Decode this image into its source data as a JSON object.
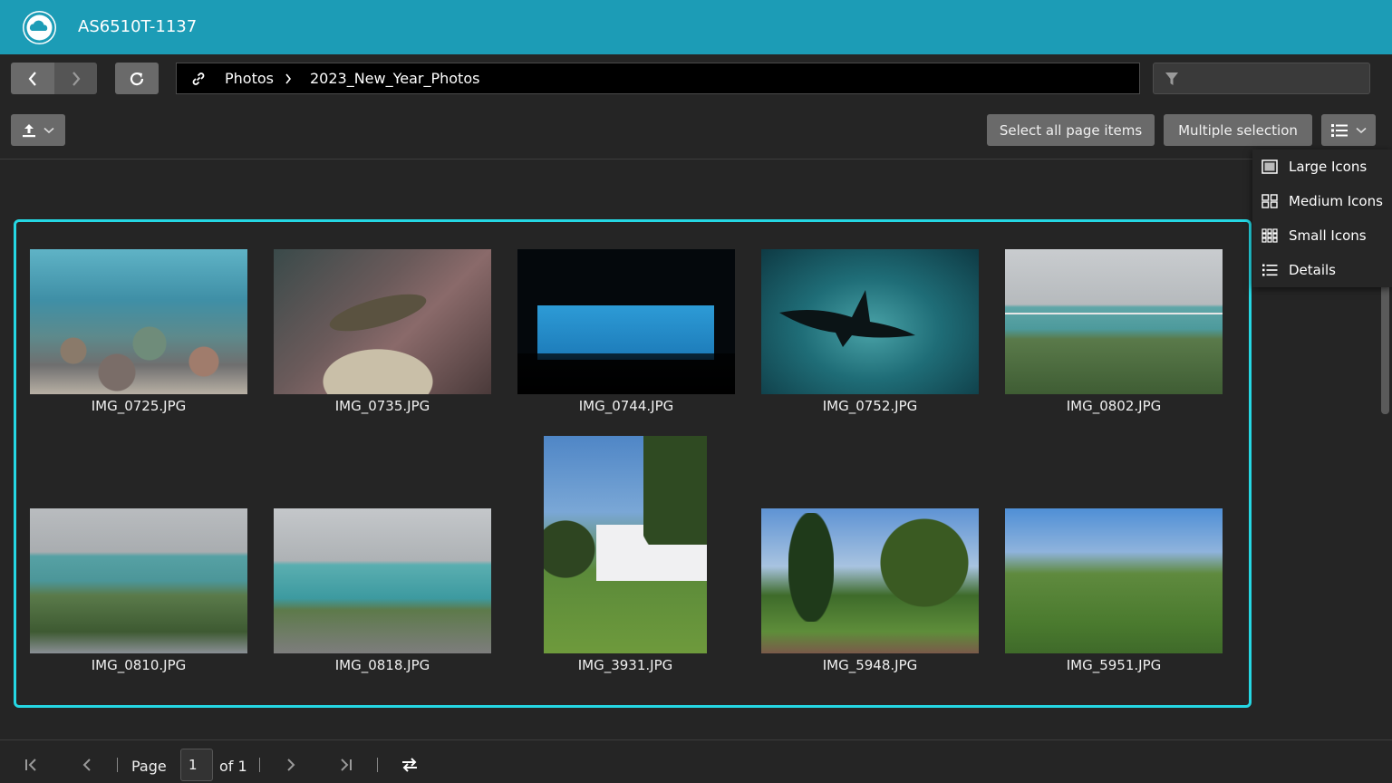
{
  "app": {
    "title": "AS6510T-1137"
  },
  "path": {
    "segments": [
      "Photos",
      "2023_New_Year_Photos"
    ]
  },
  "filter": {
    "value": ""
  },
  "toolbar": {
    "select_all_label": "Select all page items",
    "multiple_selection_label": "Multiple selection"
  },
  "view_menu": {
    "items": [
      {
        "label": "Large Icons",
        "icon": "large-icons-icon"
      },
      {
        "label": "Medium Icons",
        "icon": "medium-icons-icon"
      },
      {
        "label": "Small Icons",
        "icon": "small-icons-icon"
      },
      {
        "label": "Details",
        "icon": "details-list-icon"
      }
    ]
  },
  "photos": [
    {
      "name": "IMG_0725.JPG"
    },
    {
      "name": "IMG_0735.JPG"
    },
    {
      "name": "IMG_0744.JPG"
    },
    {
      "name": "IMG_0752.JPG"
    },
    {
      "name": "IMG_0802.JPG"
    },
    {
      "name": "IMG_0810.JPG"
    },
    {
      "name": "IMG_0818.JPG"
    },
    {
      "name": "IMG_3931.JPG"
    },
    {
      "name": "IMG_5948.JPG"
    },
    {
      "name": "IMG_5951.JPG"
    }
  ],
  "pager": {
    "page_label": "Page",
    "current_page": "1",
    "of_label": "of 1"
  },
  "colors": {
    "header": "#1c9cb6",
    "selection_border": "#25d7e3"
  }
}
